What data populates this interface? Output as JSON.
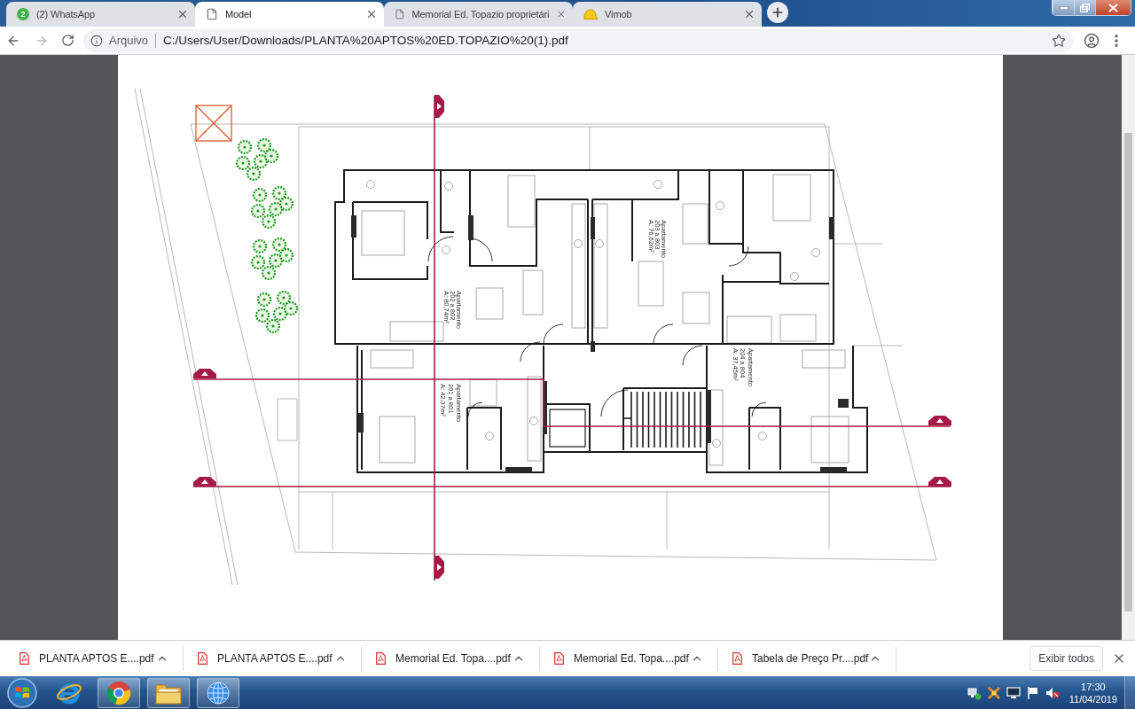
{
  "tabs": [
    {
      "kind": "badge",
      "badge": "2",
      "title": "(2) WhatsApp",
      "selected": false
    },
    {
      "kind": "document",
      "title": "Model",
      "selected": true
    },
    {
      "kind": "document",
      "title": "Memorial Ed. Topazio proprietári",
      "selected": false
    },
    {
      "kind": "site",
      "title": "Vimob",
      "selected": false
    }
  ],
  "address_bar": {
    "scheme": "Arquivo",
    "url": "C:/Users/User/Downloads/PLANTA%20APTOS%20ED.TOPAZIO%20(1).pdf"
  },
  "document": {
    "apartments": [
      {
        "title": "Apartamento",
        "units": "202 a 802",
        "area": "A: 80,74m²"
      },
      {
        "title": "Apartamento",
        "units": "203 a 803",
        "area": "A: 76,62m²"
      },
      {
        "title": "Apartamento",
        "units": "201 a 801",
        "area": "A: 42,37m²"
      },
      {
        "title": "Apartamento",
        "units": "204 a 804",
        "area": "A: 37,45m²"
      }
    ]
  },
  "downloads": {
    "items": [
      {
        "name": "PLANTA APTOS E....pdf"
      },
      {
        "name": "PLANTA APTOS E....pdf"
      },
      {
        "name": "Memorial Ed. Topa....pdf"
      },
      {
        "name": "Memorial Ed. Topa....pdf"
      },
      {
        "name": "Tabela de Preço Pr....pdf"
      }
    ],
    "show_all": "Exibir todos"
  },
  "taskbar": {
    "apps": [
      {
        "kind": "ie",
        "running": false
      },
      {
        "kind": "chrome",
        "running": true
      },
      {
        "kind": "explorer",
        "running": true
      },
      {
        "kind": "globe",
        "running": true
      }
    ],
    "clock": {
      "time": "17:30",
      "date": "11/04/2019"
    }
  }
}
